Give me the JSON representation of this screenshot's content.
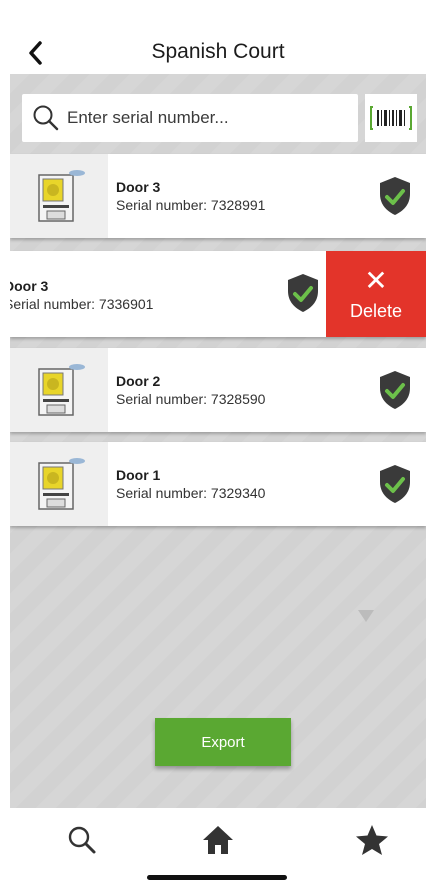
{
  "header": {
    "title": "Spanish Court"
  },
  "search": {
    "placeholder": "Enter serial number..."
  },
  "doors": [
    {
      "name": "Door 3",
      "serial_text": "Serial number: 7328991",
      "status": "verified"
    },
    {
      "name": "Door 3",
      "serial_text": "Serial number: 7336901",
      "status": "verified",
      "swiped": true
    },
    {
      "name": "Door 2",
      "serial_text": "Serial number: 7328590",
      "status": "verified"
    },
    {
      "name": "Door 1",
      "serial_text": "Serial number: 7329340",
      "status": "verified"
    }
  ],
  "swipe_action": {
    "icon": "close-icon",
    "label": "Delete"
  },
  "export": {
    "label": "Export"
  },
  "tabbar": {
    "items": [
      {
        "icon": "search-icon"
      },
      {
        "icon": "home-icon"
      },
      {
        "icon": "star-icon"
      }
    ]
  },
  "colors": {
    "accent_green": "#5aa832",
    "shield_dark": "#3a3a3a",
    "check_green": "#6cc04a",
    "delete_red": "#e3342a",
    "background_grey": "#d2d2d2"
  }
}
